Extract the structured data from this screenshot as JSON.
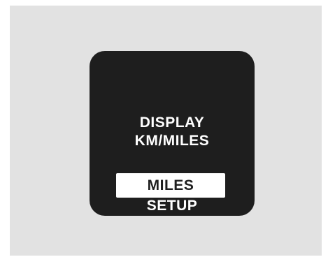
{
  "display": {
    "title_line1": "DISPLAY",
    "title_line2": "KM/MILES",
    "selected_option": "MILES",
    "softkey_label": "SETUP"
  },
  "colors": {
    "screen_background": "#1e1e1e",
    "text": "#ffffff",
    "highlight_background": "#ffffff",
    "frame_background": "#e2e2e2"
  }
}
